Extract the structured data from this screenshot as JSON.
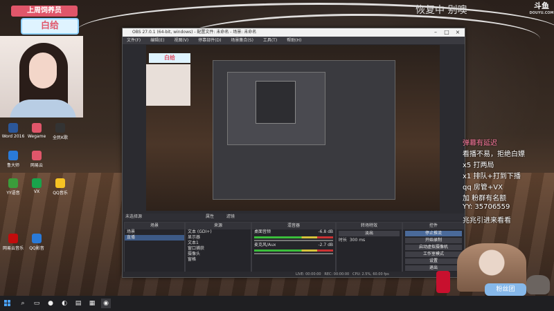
{
  "overlay": {
    "top_tag": "上周饲养员",
    "name_tag": "白给",
    "watermark_top": "恢复中 别噢",
    "corner_logo": "斗鱼",
    "corner_logo_sub": "DOUYU.COM",
    "right_lines": [
      "弹幕有延迟",
      "看播不易，拒绝白嫖",
      "x5 打两局",
      "x1 排队+打到下播",
      "qq  房管+VX",
      "加 粉群有名额",
      "YY: 35706559",
      "兆兆引进来看看"
    ],
    "badge_text": "粉丝团"
  },
  "desktop_icons": [
    {
      "label": "Word 2016",
      "color": "#2b579a"
    },
    {
      "label": "Wegame",
      "color": "#e0566a"
    },
    {
      "label": "全民K歌",
      "color": "#333"
    },
    {
      "label": "鲁大师",
      "color": "#2a7ad8"
    },
    {
      "label": "网易云",
      "color": "#e0566a"
    },
    {
      "label": "YY语音",
      "color": "#3b9c3b"
    },
    {
      "label": "VX",
      "color": "#19a34b"
    },
    {
      "label": "QQ音乐",
      "color": "#f7c323"
    },
    {
      "label": "网易云音乐",
      "color": "#c20c0c"
    },
    {
      "label": "QQ影音",
      "color": "#2a7ad8"
    }
  ],
  "obs": {
    "title": "OBS 27.0.1 (64-bit, windows) - 配置文件: 未命名 - 场景: 未命名",
    "menu": [
      "文件(F)",
      "编辑(E)",
      "视图(V)",
      "停靠部件(D)",
      "场景集合(S)",
      "工具(T)",
      "帮助(H)"
    ],
    "no_source_selected": "未选择源",
    "properties": "属性",
    "filters": "滤镜",
    "docks": {
      "scenes": {
        "title": "场景",
        "items": [
          "场景",
          "直播"
        ]
      },
      "sources": {
        "title": "来源",
        "items": [
          "文本 (GDI+)",
          "显示器",
          "文本1",
          "窗口捕获",
          "摄像头",
          "窗格"
        ]
      },
      "mixer": {
        "title": "混音器",
        "channels": [
          {
            "name": "桌面音频",
            "db": "-6.8 dB"
          },
          {
            "name": "麦克风/Aux",
            "db": "-2.7 dB"
          }
        ]
      },
      "transitions": {
        "title": "转场特效",
        "type": "淡出",
        "duration_label": "时长",
        "duration_value": "300 ms"
      },
      "controls": {
        "title": "控件",
        "buttons": [
          "停止推流",
          "开始录制",
          "启动虚拟摄像机",
          "工作室模式",
          "设置",
          "退出"
        ]
      }
    },
    "status": {
      "live": "LIVE: 00:00:00",
      "rec": "REC: 00:00:00",
      "cpu": "CPU: 2.5%, 60.00 fps"
    }
  },
  "taskbar": {
    "search_icon": "search-icon",
    "time": ""
  }
}
